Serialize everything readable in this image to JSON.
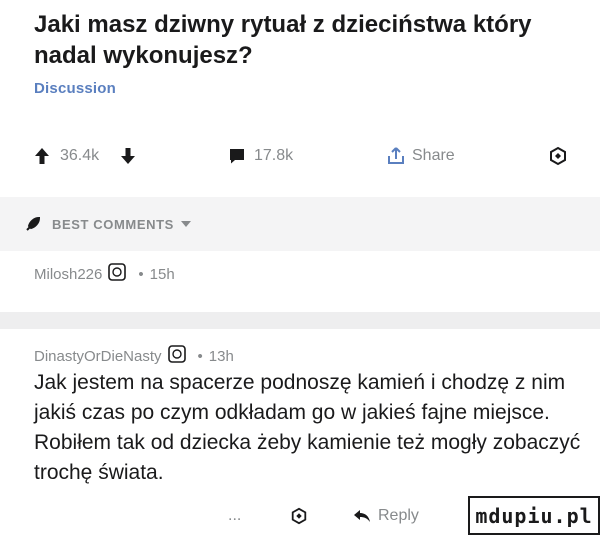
{
  "post": {
    "title": "Jaki masz dziwny rytuał z dzieciństwa który nadal wykonujesz?",
    "flair": "Discussion",
    "upvotes": "36.4k",
    "comments": "17.8k",
    "share_label": "Share"
  },
  "best_comments": {
    "label": "BEST COMMENTS"
  },
  "comment1": {
    "author": "Milosh226",
    "time": "15h"
  },
  "comment2": {
    "author": "DinastyOrDieNasty",
    "time": "13h",
    "text": "Jak jestem na spacerze podnoszę kamień i chodzę z nim jakiś czas po czym odkładam go w jakieś fajne miejsce. Robiłem tak od dziecka żeby kamienie też mogły zobaczyć trochę świata.",
    "reply_label": "Reply",
    "more_label": "..."
  },
  "watermark": "mdupiu.pl",
  "colors": {
    "accent": "#5a7fbf",
    "muted": "#878a8c",
    "text": "#1a1a1b",
    "bar": "#f4f4f5"
  }
}
